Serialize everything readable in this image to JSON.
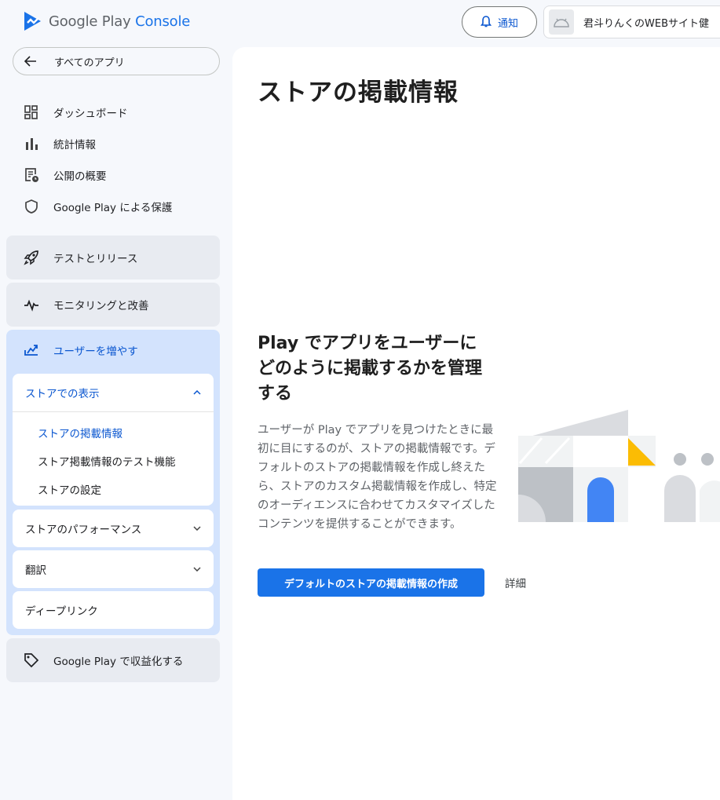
{
  "header": {
    "logo_text_main": "Google Play",
    "logo_text_accent": "Console",
    "notify_label": "通知",
    "app_name": "君斗りんくのWEBサイト健"
  },
  "sidebar": {
    "back_label": "すべてのアプリ",
    "items": [
      {
        "label": "ダッシュボード",
        "icon": "dashboard-icon"
      },
      {
        "label": "統計情報",
        "icon": "bar-chart-icon"
      },
      {
        "label": "公開の概要",
        "icon": "publishing-overview-icon"
      },
      {
        "label": "Google Play による保護",
        "icon": "shield-icon"
      }
    ],
    "sections": {
      "test_release": "テストとリリース",
      "monitor": "モニタリングと改善",
      "grow": "ユーザーを増やす",
      "monetize": "Google Play で収益化する"
    },
    "grow_cards": {
      "store_presence": "ストアでの表示",
      "store_listing": "ストアの掲載情報",
      "listing_experiments": "ストア掲載情報のテスト機能",
      "store_settings": "ストアの設定",
      "store_performance": "ストアのパフォーマンス",
      "translation": "翻訳",
      "deep_links": "ディープリンク"
    }
  },
  "main": {
    "title": "ストアの掲載情報",
    "hero_title": "Play でアプリをユーザーにどのように掲載するかを管理する",
    "hero_body": "ユーザーが Play でアプリを見つけたときに最初に目にするのが、ストアの掲載情報です。デフォルトのストアの掲載情報を作成し終えたら、ストアのカスタム掲載情報を作成し、特定のオーディエンスに合わせてカスタマイズしたコンテンツを提供することができます。",
    "cta_label": "デフォルトのストアの掲載情報の作成",
    "learn_more": "詳細"
  },
  "colors": {
    "accent": "#1a73e8",
    "active_section_bg": "#d3e3fd",
    "illustration_blue": "#4285f4",
    "illustration_yellow": "#fbbc04"
  }
}
